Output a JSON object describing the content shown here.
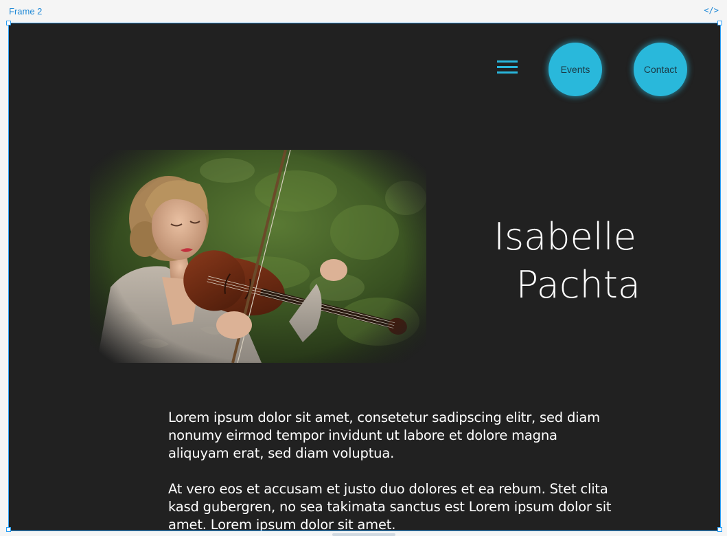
{
  "editor": {
    "frame_label": "Frame 2",
    "code_toggle": "</>"
  },
  "nav": {
    "menu_icon": "hamburger-menu-icon",
    "events_label": "Events",
    "contact_label": "Contact",
    "accent_color": "#29b8db"
  },
  "hero": {
    "image": "woman-playing-violin-photo",
    "name_line1": "Isabelle",
    "name_line2": "Pachta"
  },
  "content": {
    "paragraph1": "Lorem ipsum dolor sit amet, consetetur sadipscing elitr, sed diam nonumy eirmod tempor invidunt ut labore et dolore magna aliquyam erat, sed diam voluptua.",
    "paragraph2": "At vero eos et accusam et justo duo dolores et ea rebum. Stet clita kasd gubergren, no sea takimata sanctus est Lorem ipsum dolor sit amet. Lorem ipsum dolor sit amet."
  },
  "colors": {
    "frame_background": "#212121",
    "selection_border": "#2a9df4"
  }
}
